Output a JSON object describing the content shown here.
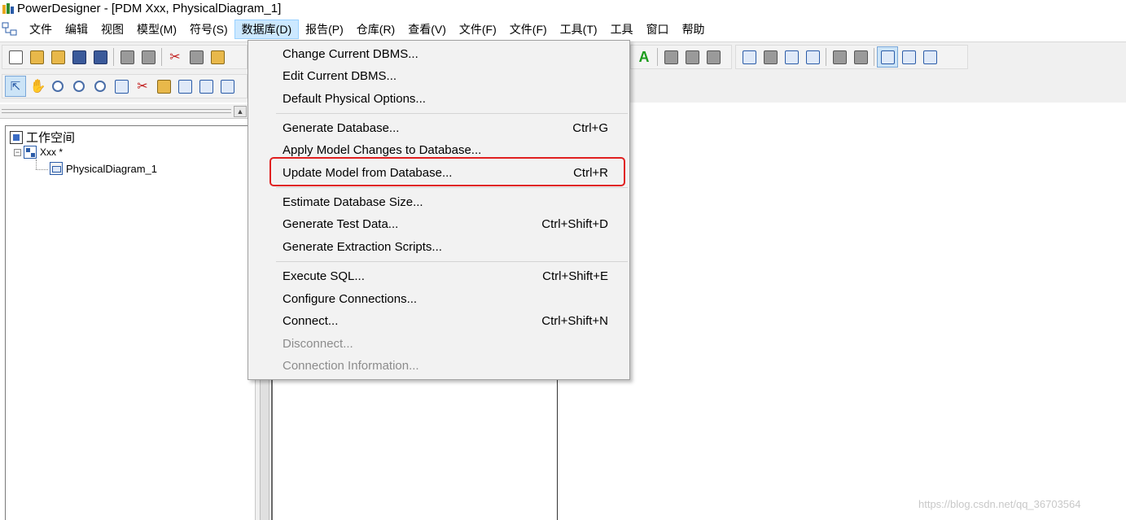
{
  "window": {
    "title": "PowerDesigner - [PDM Xxx, PhysicalDiagram_1]"
  },
  "menubar": {
    "items": [
      {
        "label": "文件"
      },
      {
        "label": "编辑"
      },
      {
        "label": "视图"
      },
      {
        "label": "模型(M)"
      },
      {
        "label": "符号(S)"
      },
      {
        "label": "数据库(D)"
      },
      {
        "label": "报告(P)"
      },
      {
        "label": "仓库(R)"
      },
      {
        "label": "查看(V)"
      },
      {
        "label": "文件(F)"
      },
      {
        "label": "文件(F)"
      },
      {
        "label": "工具(T)"
      },
      {
        "label": "工具"
      },
      {
        "label": "窗口"
      },
      {
        "label": "帮助"
      }
    ],
    "active_index": 5
  },
  "database_menu": {
    "items": [
      {
        "label": "Change Current DBMS...",
        "shortcut": "",
        "enabled": true
      },
      {
        "label": "Edit Current DBMS...",
        "shortcut": "",
        "enabled": true
      },
      {
        "label": "Default Physical Options...",
        "shortcut": "",
        "enabled": true
      },
      {
        "label": "Generate Database...",
        "shortcut": "Ctrl+G",
        "enabled": true
      },
      {
        "label": "Apply Model Changes to Database...",
        "shortcut": "",
        "enabled": true
      },
      {
        "label": "Update Model from Database...",
        "shortcut": "Ctrl+R",
        "enabled": true,
        "highlighted": true
      },
      {
        "label": "Estimate Database Size...",
        "shortcut": "",
        "enabled": true
      },
      {
        "label": "Generate Test Data...",
        "shortcut": "Ctrl+Shift+D",
        "enabled": true
      },
      {
        "label": "Generate Extraction Scripts...",
        "shortcut": "",
        "enabled": true
      },
      {
        "label": "Execute SQL...",
        "shortcut": "Ctrl+Shift+E",
        "enabled": true
      },
      {
        "label": "Configure Connections...",
        "shortcut": "",
        "enabled": true
      },
      {
        "label": "Connect...",
        "shortcut": "Ctrl+Shift+N",
        "enabled": true
      },
      {
        "label": "Disconnect...",
        "shortcut": "",
        "enabled": false
      },
      {
        "label": "Connection Information...",
        "shortcut": "",
        "enabled": false
      }
    ]
  },
  "browser": {
    "workspace": "工作空间",
    "model": "Xxx *",
    "diagram": "PhysicalDiagram_1"
  },
  "watermark": "https://blog.csdn.net/qq_36703564",
  "colors": {
    "highlight_box": "#e02020",
    "active_menu_bg": "#cce8ff",
    "disabled_text": "#8c8c8c"
  }
}
